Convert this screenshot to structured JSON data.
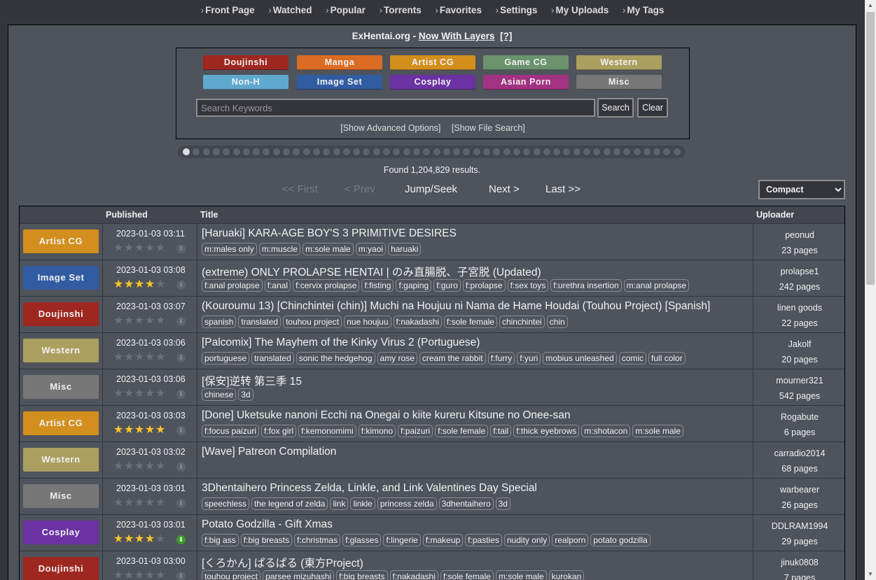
{
  "nav": [
    "Front Page",
    "Watched",
    "Popular",
    "Torrents",
    "Favorites",
    "Settings",
    "My Uploads",
    "My Tags"
  ],
  "site": {
    "name": "ExHentai.org",
    "sep": " - ",
    "link": "Now With Layers",
    "help": "[?]"
  },
  "categories": [
    {
      "label": "Doujinshi",
      "color": "#9e2720"
    },
    {
      "label": "Manga",
      "color": "#db6c24"
    },
    {
      "label": "Artist CG",
      "color": "#d38f1d"
    },
    {
      "label": "Game CG",
      "color": "#6a936d"
    },
    {
      "label": "Western",
      "color": "#ab9f60"
    },
    {
      "label": "Non-H",
      "color": "#5fa9cf"
    },
    {
      "label": "Image Set",
      "color": "#325ca2"
    },
    {
      "label": "Cosplay",
      "color": "#6a32a2"
    },
    {
      "label": "Asian Porn",
      "color": "#a23282"
    },
    {
      "label": "Misc",
      "color": "#777777"
    }
  ],
  "search": {
    "placeholder": "Search Keywords",
    "search_label": "Search",
    "clear_label": "Clear"
  },
  "options": {
    "advanced": "[Show Advanced Options]",
    "file": "[Show File Search]"
  },
  "found": "Found 1,204,829 results.",
  "pager": {
    "first": "<< First",
    "prev": "< Prev",
    "jump": "Jump/Seek",
    "next": "Next >",
    "last": "Last >>"
  },
  "display_mode": "Compact",
  "columns": {
    "published": "Published",
    "title": "Title",
    "uploader": "Uploader"
  },
  "galleries": [
    {
      "category": "Artist CG",
      "color": "#d38f1d",
      "date": "2023-01-03 03:11",
      "rating": 0,
      "torrent": false,
      "title": "[Haruaki] KARA-AGE BOY'S 3 PRIMITIVE DESIRES",
      "tags": [
        "m:males only",
        "m:muscle",
        "m:sole male",
        "m:yaoi",
        "haruaki"
      ],
      "uploader": "peonud",
      "pages": "23 pages"
    },
    {
      "category": "Image Set",
      "color": "#325ca2",
      "date": "2023-01-03 03:08",
      "rating": 4.5,
      "torrent": false,
      "title": "(extreme) ONLY PROLAPSE HENTAI | のみ直腸脱、子宮脱 (Updated)",
      "tags": [
        "f:anal prolapse",
        "f:anal",
        "f:cervix prolapse",
        "f:fisting",
        "f:gaping",
        "f:guro",
        "f:prolapse",
        "f:sex toys",
        "f:urethra insertion",
        "m:anal prolapse"
      ],
      "uploader": "prolapse1",
      "pages": "242 pages"
    },
    {
      "category": "Doujinshi",
      "color": "#9e2720",
      "date": "2023-01-03 03:07",
      "rating": 0,
      "torrent": false,
      "title": "(Kouroumu 13) [Chinchintei (chin)] Muchi na Houjuu ni Nama de Hame Houdai (Touhou Project) [Spanish]",
      "tags": [
        "spanish",
        "translated",
        "touhou project",
        "nue houjuu",
        "f:nakadashi",
        "f:sole female",
        "chinchintei",
        "chin"
      ],
      "uploader": "linen goods",
      "pages": "22 pages"
    },
    {
      "category": "Western",
      "color": "#ab9f60",
      "date": "2023-01-03 03:06",
      "rating": 0,
      "torrent": false,
      "title": "[Palcomix] The Mayhem of the Kinky Virus 2 (Portuguese)",
      "tags": [
        "portuguese",
        "translated",
        "sonic the hedgehog",
        "amy rose",
        "cream the rabbit",
        "f:furry",
        "f:yuri",
        "mobius unleashed",
        "comic",
        "full color"
      ],
      "uploader": "Jakolf",
      "pages": "20 pages"
    },
    {
      "category": "Misc",
      "color": "#777777",
      "date": "2023-01-03 03:06",
      "rating": 0,
      "torrent": false,
      "title": "[保安]逆转 第三季 15",
      "tags": [
        "chinese",
        "3d"
      ],
      "uploader": "mourner321",
      "pages": "542 pages"
    },
    {
      "category": "Artist CG",
      "color": "#d38f1d",
      "date": "2023-01-03 03:03",
      "rating": 5,
      "torrent": false,
      "title": "[Done] Uketsuke nanoni Ecchi na Onegai o kiite kureru Kitsune no Onee-san",
      "tags": [
        "f:focus paizuri",
        "f:fox girl",
        "f:kemonomimi",
        "f:kimono",
        "f:paizuri",
        "f:sole female",
        "f:tail",
        "f:thick eyebrows",
        "m:shotacon",
        "m:sole male"
      ],
      "uploader": "Rogabute",
      "pages": "6 pages"
    },
    {
      "category": "Western",
      "color": "#ab9f60",
      "date": "2023-01-03 03:02",
      "rating": 0,
      "torrent": false,
      "title": "[Wave] Patreon Compilation",
      "tags": [],
      "uploader": "carradio2014",
      "pages": "68 pages"
    },
    {
      "category": "Misc",
      "color": "#777777",
      "date": "2023-01-03 03:01",
      "rating": 0,
      "torrent": false,
      "title": "3Dhentaihero Princess Zelda, Linkle, and Link Valentines Day Special",
      "tags": [
        "speechless",
        "the legend of zelda",
        "link",
        "linkle",
        "princess zelda",
        "3dhentaihero",
        "3d"
      ],
      "uploader": "warbearer",
      "pages": "26 pages"
    },
    {
      "category": "Cosplay",
      "color": "#6a32a2",
      "date": "2023-01-03 03:01",
      "rating": 4.5,
      "torrent": true,
      "title": "Potato Godzilla - Gift Xmas",
      "tags": [
        "f:big ass",
        "f:big breasts",
        "f:christmas",
        "f:glasses",
        "f:lingerie",
        "f:makeup",
        "f:pasties",
        "nudity only",
        "realporn",
        "potato godzilla"
      ],
      "uploader": "DDLRAM1994",
      "pages": "29 pages"
    },
    {
      "category": "Doujinshi",
      "color": "#9e2720",
      "date": "2023-01-03 03:00",
      "rating": 0,
      "torrent": false,
      "title": "[くろかん] ぱるぱる (東方Project)",
      "tags": [
        "touhou project",
        "parsee mizuhashi",
        "f:big breasts",
        "f:nakadashi",
        "f:sole female",
        "m:sole male",
        "kurokan"
      ],
      "uploader": "jinuk0808",
      "pages": "7 pages"
    }
  ]
}
